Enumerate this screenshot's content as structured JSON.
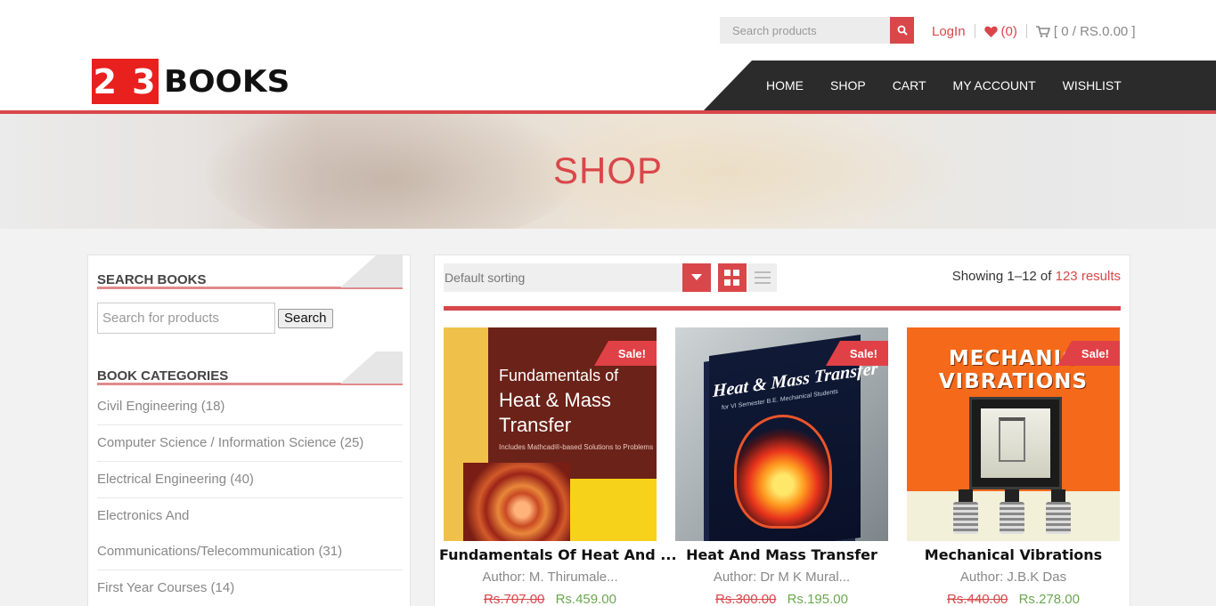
{
  "logo": {
    "number": "2 3",
    "word": "BOOKS"
  },
  "top_search": {
    "placeholder": "Search products"
  },
  "top_links": {
    "login": "LogIn",
    "wishlist_count": "(0)",
    "cart": "[ 0 / RS.0.00 ]"
  },
  "nav": [
    "HOME",
    "SHOP",
    "CART",
    "MY ACCOUNT",
    "WISHLIST"
  ],
  "banner": {
    "title": "SHOP"
  },
  "sidebar": {
    "search_title": "SEARCH BOOKS",
    "search_placeholder": "Search for products",
    "search_button": "Search",
    "categories_title": "BOOK CATEGORIES",
    "categories": [
      "Civil Engineering (18)",
      "Computer Science / Information Science (25)",
      "Electrical Engineering (40)",
      "Electronics And",
      "Communications/Telecommunication (31)",
      "First Year Courses (14)"
    ]
  },
  "toolbar": {
    "sorting": "Default sorting",
    "showing_prefix": "Showing 1–12 of",
    "showing_count": "123 results"
  },
  "products": [
    {
      "title": "Fundamentals Of Heat And ...",
      "author": "Author: M. Thirumale...",
      "old_price": "Rs.707.00",
      "new_price": "Rs.459.00",
      "badge": "Sale!",
      "cover_text": [
        "Fundamentals of",
        "Heat & Mass",
        "Transfer",
        "Includes Mathcad®-based Solutions to Problems"
      ]
    },
    {
      "title": "Heat And Mass Transfer",
      "author": "Author: Dr M K Mural...",
      "old_price": "Rs.300.00",
      "new_price": "Rs.195.00",
      "badge": "Sale!",
      "cover_text": [
        "Heat & Mass Transfer",
        "for VI Semester B.E. Mechanical Students"
      ]
    },
    {
      "title": "Mechanical Vibrations",
      "author": "Author: J.B.K Das",
      "old_price": "Rs.440.00",
      "new_price": "Rs.278.00",
      "badge": "Sale!",
      "cover_text": [
        "MECHANIC",
        "VIBRATIONS"
      ]
    }
  ],
  "colors": {
    "accent": "#d9474a",
    "nav_bg": "#2b2b2b",
    "logo_red": "#e8201e",
    "sale_price": "#6aa84f"
  },
  "icons": {
    "search": "search-icon",
    "heart": "heart-icon",
    "cart": "cart-icon",
    "grid": "grid-view-icon",
    "list": "list-view-icon",
    "dropdown": "chevron-down-icon"
  }
}
